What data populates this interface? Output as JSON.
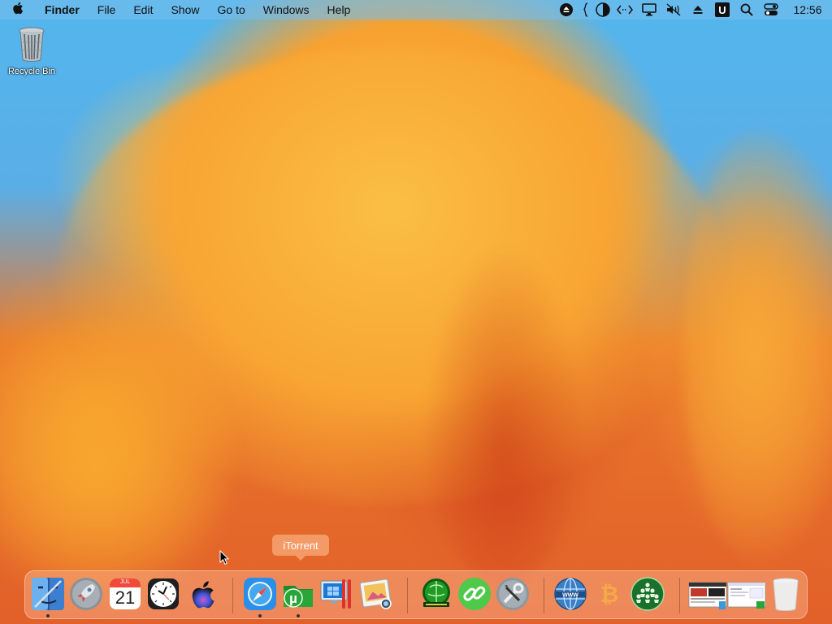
{
  "menubar": {
    "apple_icon": "apple-logo-icon",
    "app_name": "Finder",
    "items": [
      "File",
      "Edit",
      "Show",
      "Go to",
      "Windows",
      "Help"
    ],
    "clock": "12:56",
    "status_icons": [
      "eject-circle-icon",
      "curly-brace-icon",
      "pie-chart-icon",
      "code-arrows-icon",
      "display-icon",
      "mute-icon",
      "eject-icon",
      "u-app-icon",
      "search-icon",
      "control-center-icon"
    ]
  },
  "desktop": {
    "icons": [
      {
        "label": "Recycle Bin",
        "icon": "recycle-bin-icon"
      }
    ]
  },
  "tooltip": "iTorrent",
  "dock": {
    "items": [
      {
        "name": "finder",
        "icon": "finder-icon",
        "running": true
      },
      {
        "name": "launchpad",
        "icon": "rocket-icon",
        "running": false
      },
      {
        "name": "calendar",
        "icon": "calendar-icon",
        "running": false,
        "month": "JUL",
        "day": "21"
      },
      {
        "name": "clock",
        "icon": "clock-icon",
        "running": false
      },
      {
        "name": "siri",
        "icon": "apple-siri-icon",
        "running": false
      },
      {
        "name": "safari",
        "icon": "compass-icon",
        "running": true
      },
      {
        "name": "itorrent",
        "icon": "utorrent-folder-icon",
        "running": true
      },
      {
        "name": "parallels",
        "icon": "parallels-windows-icon",
        "running": false
      },
      {
        "name": "preview",
        "icon": "photo-preview-icon",
        "running": false
      },
      {
        "name": "cellarstone",
        "icon": "cellarstone-globe-icon",
        "running": false
      },
      {
        "name": "links",
        "icon": "chain-link-icon",
        "running": false
      },
      {
        "name": "utilities",
        "icon": "wrench-screwdriver-icon",
        "running": false
      },
      {
        "name": "network",
        "icon": "www-globe-icon",
        "running": false
      },
      {
        "name": "bitcoin",
        "icon": "bitcoin-icon",
        "running": false
      },
      {
        "name": "community",
        "icon": "people-circle-icon",
        "running": false
      },
      {
        "name": "window-thumbnail-1",
        "icon": "window-thumbnail-icon",
        "running": false
      },
      {
        "name": "window-thumbnail-2",
        "icon": "window-thumbnail-icon",
        "running": false
      },
      {
        "name": "trash",
        "icon": "trash-icon",
        "running": false
      }
    ],
    "calendar_month": "JUL",
    "calendar_day": "21"
  },
  "colors": {
    "sky": "#53b6ee",
    "orange": "#f7a230",
    "deep_orange": "#e2602a"
  }
}
